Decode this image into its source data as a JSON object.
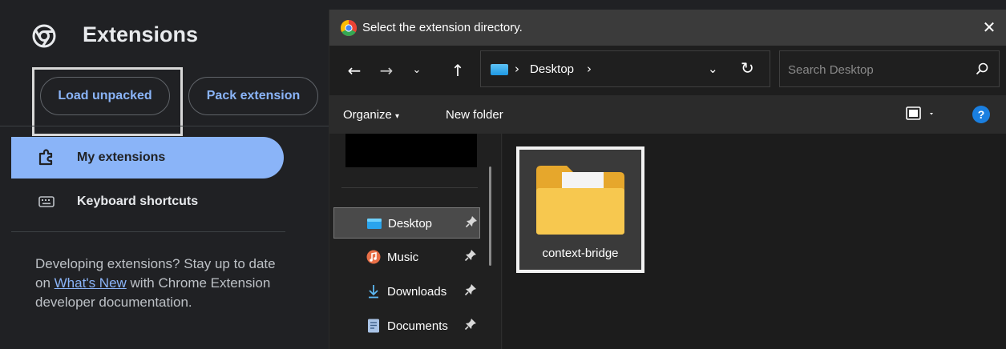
{
  "extensions_page": {
    "title": "Extensions",
    "buttons": {
      "load_unpacked": "Load unpacked",
      "pack_extension": "Pack extension"
    },
    "nav": [
      {
        "label": "My extensions",
        "icon": "puzzle-icon",
        "selected": true
      },
      {
        "label": "Keyboard shortcuts",
        "icon": "keyboard-icon",
        "selected": false
      }
    ],
    "dev_note": {
      "before_link": "Developing extensions? Stay up to date on ",
      "link": "What's New",
      "after_link": " with Chrome Extension developer documentation."
    }
  },
  "dialog": {
    "title": "Select the extension directory.",
    "close": "✕",
    "address": {
      "path_label": "Desktop",
      "separator": "›"
    },
    "search": {
      "placeholder": "Search Desktop",
      "value": ""
    },
    "toolbar": {
      "organize": "Organize",
      "new_folder": "New folder",
      "help": "?"
    },
    "quick_access": [
      {
        "label": "Desktop",
        "icon": "desktop-folder-icon",
        "pinned": true,
        "selected": true
      },
      {
        "label": "Music",
        "icon": "music-icon",
        "pinned": true,
        "selected": false
      },
      {
        "label": "Downloads",
        "icon": "download-icon",
        "pinned": true,
        "selected": false
      },
      {
        "label": "Documents",
        "icon": "documents-icon",
        "pinned": true,
        "selected": false
      }
    ],
    "items": [
      {
        "label": "context-bridge",
        "icon": "folder-icon",
        "selected": true
      }
    ]
  },
  "colors": {
    "chrome_bg": "#202124",
    "accent_blue": "#8ab4f8",
    "dialog_bg": "#202020",
    "folder_yellow": "#f6c44f"
  }
}
